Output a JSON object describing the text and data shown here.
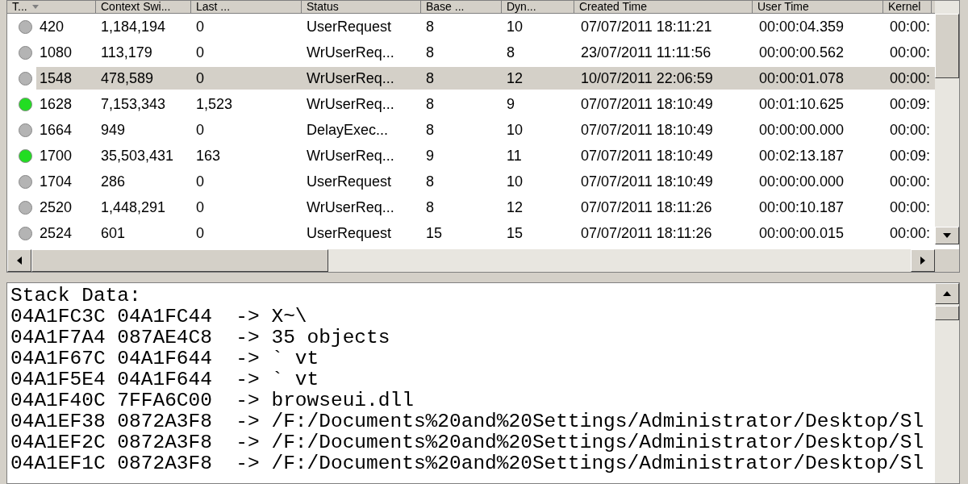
{
  "table": {
    "columns": [
      "T...",
      "Context Swi...",
      "Last ...",
      "Status",
      "Base ...",
      "Dyn...",
      "Created Time",
      "User Time",
      "Kernel"
    ],
    "rows": [
      {
        "color": "#b4b4b4",
        "selected": false,
        "cells": [
          "420",
          "1,184,194",
          "0",
          "UserRequest",
          "8",
          "10",
          "07/07/2011 18:11:21",
          "00:00:04.359",
          "00:00:"
        ]
      },
      {
        "color": "#b4b4b4",
        "selected": false,
        "cells": [
          "1080",
          "113,179",
          "0",
          "WrUserReq...",
          "8",
          "8",
          "23/07/2011 11:11:56",
          "00:00:00.562",
          "00:00:"
        ]
      },
      {
        "color": "#b4b4b4",
        "selected": true,
        "cells": [
          "1548",
          "478,589",
          "0",
          "WrUserReq...",
          "8",
          "12",
          "10/07/2011 22:06:59",
          "00:00:01.078",
          "00:00:"
        ]
      },
      {
        "color": "#22dd22",
        "selected": false,
        "cells": [
          "1628",
          "7,153,343",
          "1,523",
          "WrUserReq...",
          "8",
          "9",
          "07/07/2011 18:10:49",
          "00:01:10.625",
          "00:09:"
        ]
      },
      {
        "color": "#b4b4b4",
        "selected": false,
        "cells": [
          "1664",
          "949",
          "0",
          "DelayExec...",
          "8",
          "10",
          "07/07/2011 18:10:49",
          "00:00:00.000",
          "00:00:"
        ]
      },
      {
        "color": "#22dd22",
        "selected": false,
        "cells": [
          "1700",
          "35,503,431",
          "163",
          "WrUserReq...",
          "9",
          "11",
          "07/07/2011 18:10:49",
          "00:02:13.187",
          "00:09:"
        ]
      },
      {
        "color": "#b4b4b4",
        "selected": false,
        "cells": [
          "1704",
          "286",
          "0",
          "UserRequest",
          "8",
          "10",
          "07/07/2011 18:10:49",
          "00:00:00.000",
          "00:00:"
        ]
      },
      {
        "color": "#b4b4b4",
        "selected": false,
        "cells": [
          "2520",
          "1,448,291",
          "0",
          "WrUserReq...",
          "8",
          "12",
          "07/07/2011 18:11:26",
          "00:00:10.187",
          "00:00:"
        ]
      },
      {
        "color": "#b4b4b4",
        "selected": false,
        "cells": [
          "2524",
          "601",
          "0",
          "UserRequest",
          "15",
          "15",
          "07/07/2011 18:11:26",
          "00:00:00.015",
          "00:00:"
        ]
      }
    ]
  },
  "stack": {
    "lines": [
      "Stack Data:",
      "04A1FC3C 04A1FC44  -> X~\\",
      "04A1F7A4 087AE4C8  -> 35 objects",
      "04A1F67C 04A1F644  -> ` vt",
      "04A1F5E4 04A1F644  -> ` vt",
      "04A1F40C 7FFA6C00  -> browseui.dll",
      "04A1EF38 0872A3F8  -> /F:/Documents%20and%20Settings/Administrator/Desktop/Sl",
      "04A1EF2C 0872A3F8  -> /F:/Documents%20and%20Settings/Administrator/Desktop/Sl",
      "04A1EF1C 0872A3F8  -> /F:/Documents%20and%20Settings/Administrator/Desktop/Sl"
    ]
  }
}
